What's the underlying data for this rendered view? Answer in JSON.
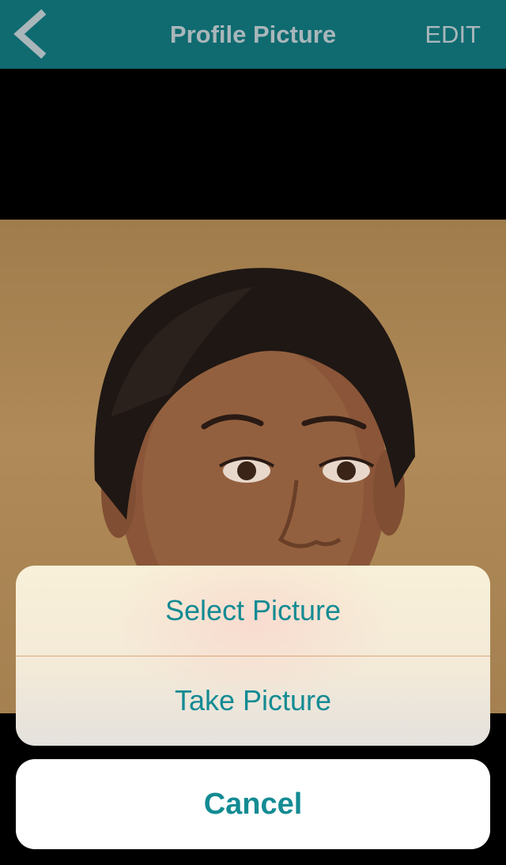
{
  "navbar": {
    "back_icon": "chevron-left-icon",
    "title": "Profile Picture",
    "edit_label": "EDIT",
    "background_color": "#0f6b70",
    "text_color": "#a9b6ba"
  },
  "photo": {
    "description_icon": "profile-photo"
  },
  "action_sheet": {
    "select_label": "Select Picture",
    "take_label": "Take Picture",
    "cancel_label": "Cancel",
    "accent_color": "#138b93"
  }
}
